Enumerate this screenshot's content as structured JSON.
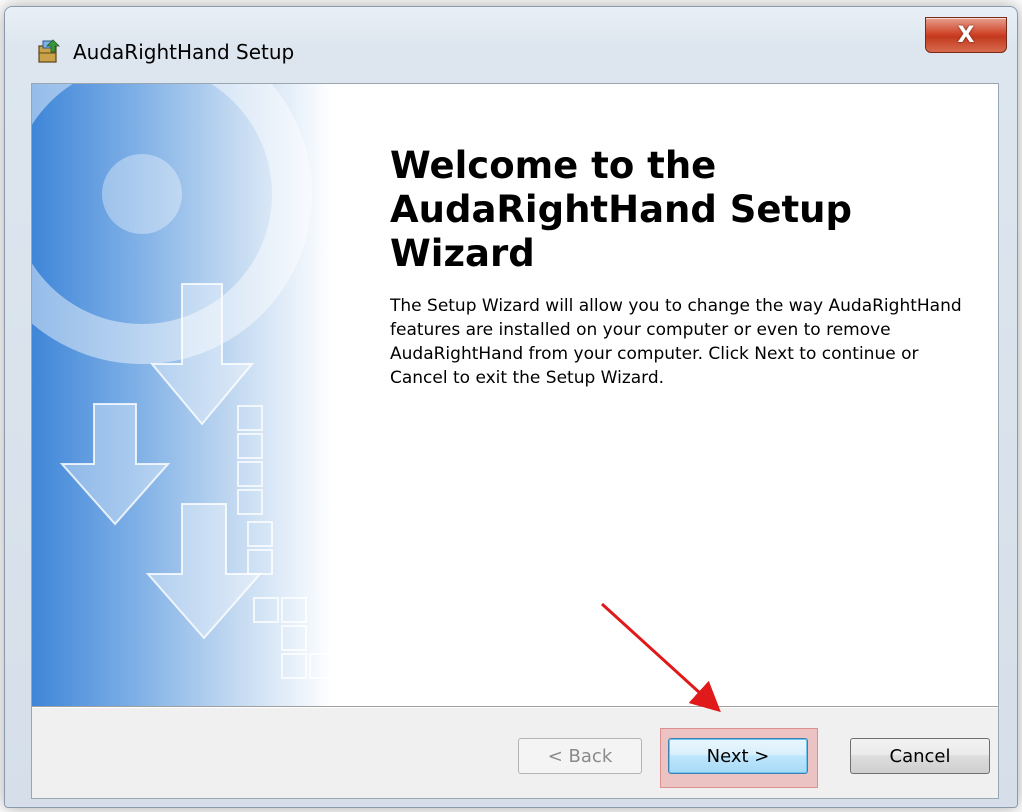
{
  "window": {
    "title": "AudaRightHand Setup",
    "close_glyph": "X"
  },
  "welcome": {
    "title_line1": "Welcome to the",
    "title_line2": "AudaRightHand Setup Wizard",
    "body": "The Setup Wizard will allow you to change the way AudaRightHand features are installed on your computer or even to remove AudaRightHand from your computer.  Click Next to continue or Cancel to exit the Setup Wizard."
  },
  "buttons": {
    "back": "< Back",
    "next": "Next >",
    "cancel": "Cancel"
  },
  "annotation": {
    "arrow_color": "#e0191b",
    "highlight_color": "#e68c8c"
  },
  "icons": {
    "app": "installer-icon",
    "close": "close-icon"
  }
}
